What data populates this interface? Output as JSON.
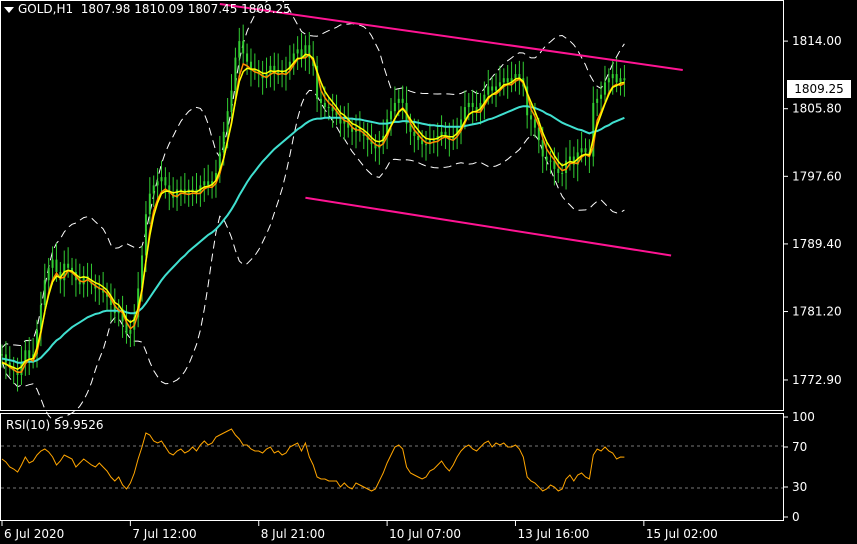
{
  "header": {
    "symbol": "GOLD,H1",
    "open": "1807.98",
    "high": "1810.09",
    "low": "1807.45",
    "close": "1809.25"
  },
  "current_price_label": "1809.25",
  "rsi_label": "RSI(10) 59.9526",
  "colors": {
    "background": "#000000",
    "grid_frame": "#ffffff",
    "candles": "#32cd32",
    "ema_fast": "#ffff00",
    "ema_mid": "#ff8c00",
    "ema_slow": "#40e0d0",
    "bollinger": "#ffffff",
    "channel": "#ff1493",
    "rsi_line": "#ffa500"
  },
  "chart_data": [
    {
      "type": "line",
      "title": "GOLD,H1",
      "y_ticks": [
        1772.9,
        1781.2,
        1789.4,
        1797.6,
        1805.8,
        1814.0
      ],
      "ylim": [
        1769.5,
        1818.5
      ],
      "x_ticks": [
        "6 Jul 2020",
        "7 Jul 12:00",
        "8 Jul 21:00",
        "10 Jul 07:00",
        "13 Jul 16:00",
        "15 Jul 02:00"
      ],
      "x_tick_index": [
        0,
        33,
        66,
        99,
        132,
        165
      ],
      "x_range": [
        0,
        200
      ],
      "last_price": 1809.25,
      "close_series": [
        1776.0,
        1775.0,
        1774.5,
        1774.0,
        1773.5,
        1775.0,
        1776.5,
        1775.5,
        1776.0,
        1779.0,
        1782.0,
        1785.0,
        1786.5,
        1787.5,
        1786.0,
        1785.0,
        1787.0,
        1786.5,
        1786.0,
        1785.0,
        1784.5,
        1785.5,
        1785.0,
        1784.5,
        1784.0,
        1784.0,
        1783.5,
        1783.0,
        1782.0,
        1781.0,
        1781.5,
        1780.0,
        1778.5,
        1779.0,
        1780.5,
        1784.0,
        1788.0,
        1793.0,
        1795.5,
        1796.5,
        1797.0,
        1797.5,
        1796.5,
        1795.5,
        1795.0,
        1796.0,
        1796.0,
        1795.5,
        1796.0,
        1796.0,
        1795.5,
        1796.5,
        1797.0,
        1796.5,
        1797.0,
        1798.0,
        1800.5,
        1803.0,
        1805.5,
        1808.0,
        1812.0,
        1814.0,
        1812.5,
        1811.5,
        1810.5,
        1810.5,
        1810.0,
        1809.5,
        1810.0,
        1811.0,
        1810.0,
        1810.5,
        1810.0,
        1810.5,
        1811.5,
        1812.5,
        1813.0,
        1812.0,
        1813.5,
        1812.0,
        1811.0,
        1807.0,
        1806.5,
        1806.0,
        1806.0,
        1805.5,
        1805.0,
        1804.0,
        1804.5,
        1803.5,
        1803.0,
        1803.5,
        1803.0,
        1802.5,
        1802.0,
        1801.5,
        1801.0,
        1801.5,
        1802.5,
        1804.5,
        1805.5,
        1806.5,
        1807.0,
        1806.5,
        1804.0,
        1803.0,
        1802.5,
        1802.0,
        1801.5,
        1801.5,
        1802.0,
        1802.0,
        1802.5,
        1803.0,
        1802.5,
        1802.0,
        1802.5,
        1803.5,
        1804.5,
        1806.0,
        1806.5,
        1806.0,
        1805.5,
        1806.5,
        1807.5,
        1808.5,
        1808.0,
        1808.5,
        1809.0,
        1809.5,
        1809.0,
        1809.5,
        1810.0,
        1809.5,
        1808.5,
        1805.0,
        1804.5,
        1803.5,
        1802.0,
        1800.0,
        1799.5,
        1799.5,
        1798.5,
        1798.0,
        1798.0,
        1799.5,
        1800.0,
        1799.0,
        1800.5,
        1801.0,
        1800.5,
        1800.0,
        1806.5,
        1807.0,
        1807.5,
        1809.0,
        1809.5,
        1810.0,
        1809.0,
        1809.5,
        1809.25
      ],
      "ema_fast": [
        1775.0,
        1774.8,
        1774.6,
        1774.4,
        1774.2,
        1774.5,
        1775.2,
        1775.4,
        1775.5,
        1776.8,
        1778.8,
        1781.2,
        1783.2,
        1784.8,
        1785.5,
        1785.3,
        1786.0,
        1786.2,
        1786.1,
        1785.7,
        1785.3,
        1785.4,
        1785.3,
        1785.0,
        1784.7,
        1784.5,
        1784.2,
        1783.8,
        1783.1,
        1782.3,
        1782.0,
        1781.3,
        1780.3,
        1779.9,
        1780.2,
        1781.6,
        1783.9,
        1787.3,
        1790.4,
        1792.8,
        1794.4,
        1795.5,
        1795.8,
        1795.8,
        1795.6,
        1795.7,
        1795.8,
        1795.7,
        1795.8,
        1795.8,
        1795.7,
        1796.0,
        1796.3,
        1796.4,
        1796.6,
        1797.1,
        1798.3,
        1799.8,
        1801.9,
        1804.0,
        1806.7,
        1809.1,
        1810.3,
        1810.7,
        1810.6,
        1810.6,
        1810.4,
        1810.1,
        1810.1,
        1810.4,
        1810.3,
        1810.4,
        1810.3,
        1810.4,
        1810.8,
        1811.4,
        1811.9,
        1811.9,
        1812.4,
        1812.3,
        1811.9,
        1810.3,
        1809.0,
        1807.9,
        1807.2,
        1806.6,
        1806.0,
        1805.3,
        1805.0,
        1804.5,
        1804.0,
        1803.8,
        1803.5,
        1803.2,
        1802.8,
        1802.3,
        1801.9,
        1801.8,
        1802.0,
        1802.8,
        1803.7,
        1804.6,
        1805.4,
        1805.8,
        1805.2,
        1804.5,
        1803.8,
        1803.2,
        1802.6,
        1802.2,
        1802.1,
        1802.1,
        1802.2,
        1802.5,
        1802.5,
        1802.4,
        1802.4,
        1802.8,
        1803.4,
        1804.3,
        1805.1,
        1805.4,
        1805.5,
        1805.8,
        1806.5,
        1807.2,
        1807.5,
        1807.8,
        1808.2,
        1808.7,
        1808.8,
        1809.0,
        1809.4,
        1809.5,
        1809.1,
        1807.7,
        1806.6,
        1805.5,
        1804.3,
        1802.9,
        1801.8,
        1801.0,
        1800.1,
        1799.4,
        1798.9,
        1799.1,
        1799.4,
        1799.3,
        1799.7,
        1800.1,
        1800.3,
        1800.2,
        1802.2,
        1803.8,
        1805.1,
        1806.4,
        1807.5,
        1808.4,
        1808.6,
        1808.9,
        1809.0
      ],
      "ema_slow": [
        1775.5,
        1775.4,
        1775.3,
        1775.2,
        1775.0,
        1775.0,
        1775.1,
        1775.1,
        1775.1,
        1775.3,
        1775.6,
        1776.1,
        1776.6,
        1777.2,
        1777.7,
        1778.0,
        1778.5,
        1778.9,
        1779.3,
        1779.6,
        1779.9,
        1780.2,
        1780.5,
        1780.7,
        1780.9,
        1781.0,
        1781.2,
        1781.3,
        1781.3,
        1781.3,
        1781.3,
        1781.3,
        1781.1,
        1781.0,
        1781.0,
        1781.2,
        1781.6,
        1782.2,
        1782.9,
        1783.6,
        1784.3,
        1785.0,
        1785.6,
        1786.1,
        1786.6,
        1787.1,
        1787.6,
        1788.0,
        1788.5,
        1788.9,
        1789.3,
        1789.7,
        1790.1,
        1790.5,
        1790.8,
        1791.2,
        1791.7,
        1792.3,
        1792.9,
        1793.6,
        1794.4,
        1795.3,
        1796.1,
        1796.9,
        1797.6,
        1798.2,
        1798.8,
        1799.4,
        1799.9,
        1800.4,
        1800.9,
        1801.3,
        1801.7,
        1802.1,
        1802.5,
        1802.9,
        1803.3,
        1803.6,
        1804.0,
        1804.3,
        1804.5,
        1804.6,
        1804.6,
        1804.7,
        1804.7,
        1804.7,
        1804.7,
        1804.7,
        1804.7,
        1804.6,
        1804.6,
        1804.5,
        1804.5,
        1804.4,
        1804.3,
        1804.2,
        1804.1,
        1804.0,
        1804.0,
        1804.0,
        1804.1,
        1804.2,
        1804.2,
        1804.3,
        1804.3,
        1804.2,
        1804.2,
        1804.1,
        1804.0,
        1803.9,
        1803.8,
        1803.8,
        1803.7,
        1803.7,
        1803.6,
        1803.6,
        1803.6,
        1803.6,
        1803.6,
        1803.7,
        1803.8,
        1803.9,
        1804.0,
        1804.1,
        1804.3,
        1804.5,
        1804.6,
        1804.8,
        1805.0,
        1805.2,
        1805.4,
        1805.6,
        1805.8,
        1806.0,
        1806.1,
        1806.1,
        1806.0,
        1805.9,
        1805.7,
        1805.5,
        1805.2,
        1805.0,
        1804.7,
        1804.4,
        1804.1,
        1803.9,
        1803.7,
        1803.5,
        1803.3,
        1803.2,
        1803.0,
        1802.8,
        1803.0,
        1803.1,
        1803.3,
        1803.6,
        1803.8,
        1804.1,
        1804.3,
        1804.5,
        1804.7
      ],
      "channel_upper": [
        [
          56,
          1818.5
        ],
        [
          175,
          1810.5
        ]
      ],
      "channel_lower": [
        [
          78,
          1795.0
        ],
        [
          172,
          1788.0
        ]
      ]
    },
    {
      "type": "line",
      "title": "RSI(10) 59.9526",
      "y_ticks": [
        0,
        30,
        70,
        100
      ],
      "levels": [
        30,
        70
      ],
      "ylim": [
        0,
        100
      ],
      "rsi_values": [
        58,
        55,
        50,
        48,
        45,
        52,
        60,
        54,
        56,
        62,
        66,
        68,
        65,
        60,
        52,
        56,
        62,
        60,
        58,
        50,
        54,
        58,
        55,
        52,
        50,
        54,
        50,
        46,
        40,
        36,
        40,
        32,
        28,
        34,
        44,
        58,
        70,
        84,
        82,
        76,
        74,
        76,
        70,
        64,
        62,
        66,
        68,
        64,
        66,
        70,
        66,
        72,
        76,
        72,
        74,
        80,
        82,
        84,
        86,
        88,
        82,
        78,
        72,
        72,
        68,
        66,
        66,
        64,
        68,
        70,
        64,
        66,
        62,
        64,
        70,
        72,
        74,
        66,
        74,
        60,
        52,
        40,
        38,
        38,
        36,
        36,
        36,
        30,
        34,
        30,
        28,
        34,
        32,
        30,
        28,
        26,
        28,
        36,
        44,
        54,
        62,
        70,
        72,
        68,
        50,
        44,
        42,
        40,
        38,
        40,
        46,
        48,
        52,
        56,
        50,
        46,
        52,
        60,
        66,
        70,
        72,
        68,
        66,
        70,
        74,
        76,
        70,
        74,
        72,
        74,
        70,
        70,
        72,
        68,
        60,
        40,
        36,
        34,
        30,
        26,
        28,
        32,
        30,
        26,
        28,
        38,
        42,
        36,
        42,
        44,
        40,
        38,
        62,
        68,
        66,
        70,
        66,
        64,
        58,
        60,
        59.95
      ]
    }
  ]
}
